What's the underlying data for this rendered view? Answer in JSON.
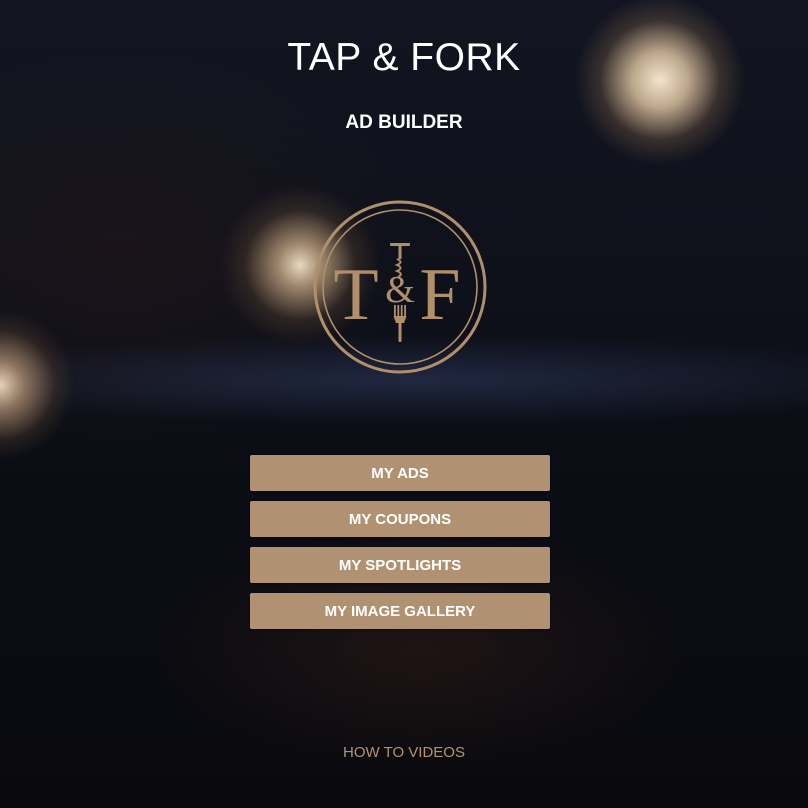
{
  "header": {
    "title": "TAP & FORK",
    "subtitle": "AD BUILDER"
  },
  "logo": {
    "monogram_left": "T",
    "monogram_amp": "&",
    "monogram_right": "F",
    "color": "#b08f6b"
  },
  "menu": {
    "items": [
      {
        "label": "MY ADS"
      },
      {
        "label": "MY COUPONS"
      },
      {
        "label": "MY SPOTLIGHTS"
      },
      {
        "label": "MY IMAGE GALLERY"
      }
    ]
  },
  "footer": {
    "link_label": "HOW TO VIDEOS"
  },
  "colors": {
    "button_bg": "#b09273",
    "button_text": "#ffffff",
    "link_text": "#b39373",
    "background": "#0e1019"
  }
}
